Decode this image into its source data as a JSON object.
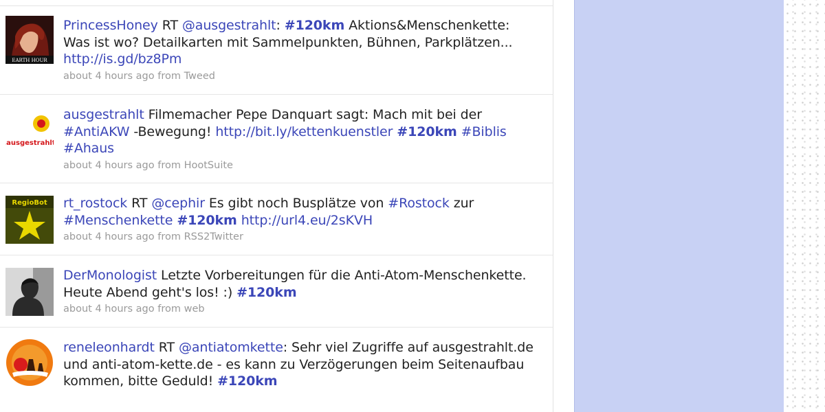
{
  "tweets": [
    {
      "user": "PrincessHoney",
      "avatar_text": "EARTH HOUR",
      "parts": [
        {
          "text": " RT ",
          "kind": "plain"
        },
        {
          "text": "@ausgestrahlt",
          "kind": "mention"
        },
        {
          "text": ": ",
          "kind": "plain"
        },
        {
          "text": "#120km",
          "kind": "hashtag"
        },
        {
          "text": " Aktions&Menschenkette: Was ist wo? Detailkarten mit Sammelpunkten, Bühnen, Parkplätzen... ",
          "kind": "plain"
        },
        {
          "text": "http://is.gd/bz8Pm",
          "kind": "link"
        }
      ],
      "time": "about 4 hours ago",
      "from_word": "from",
      "source": "Tweed"
    },
    {
      "user": "ausgestrahlt",
      "avatar_text": ".ausgestrahlt",
      "parts": [
        {
          "text": " Filmemacher Pepe Danquart sagt: Mach mit bei der ",
          "kind": "plain"
        },
        {
          "text": "#AntiAKW",
          "kind": "mention"
        },
        {
          "text": " -Bewegung! ",
          "kind": "plain"
        },
        {
          "text": "http://bit.ly/kettenkuenstler",
          "kind": "link"
        },
        {
          "text": " ",
          "kind": "plain"
        },
        {
          "text": "#120km",
          "kind": "hashtag"
        },
        {
          "text": " ",
          "kind": "plain"
        },
        {
          "text": "#Biblis",
          "kind": "mention"
        },
        {
          "text": " ",
          "kind": "plain"
        },
        {
          "text": "#Ahaus",
          "kind": "mention"
        }
      ],
      "time": "about 4 hours ago",
      "from_word": "from",
      "source": "HootSuite"
    },
    {
      "user": "rt_rostock",
      "avatar_text": "RegioBot",
      "parts": [
        {
          "text": " RT ",
          "kind": "plain"
        },
        {
          "text": "@cephir",
          "kind": "mention"
        },
        {
          "text": " Es gibt noch Busplätze von ",
          "kind": "plain"
        },
        {
          "text": "#Rostock",
          "kind": "mention"
        },
        {
          "text": " zur ",
          "kind": "plain"
        },
        {
          "text": "#Menschenkette",
          "kind": "mention"
        },
        {
          "text": " ",
          "kind": "plain"
        },
        {
          "text": "#120km",
          "kind": "hashtag"
        },
        {
          "text": " ",
          "kind": "plain"
        },
        {
          "text": "http://url4.eu/2sKVH",
          "kind": "link"
        }
      ],
      "time": "about 4 hours ago",
      "from_word": "from",
      "source": "RSS2Twitter"
    },
    {
      "user": "DerMonologist",
      "avatar_text": "",
      "parts": [
        {
          "text": " Letzte Vorbereitungen für die Anti-Atom-Menschenkette. Heute Abend geht's los! :) ",
          "kind": "plain"
        },
        {
          "text": "#120km",
          "kind": "hashtag"
        }
      ],
      "time": "about 4 hours ago",
      "from_word": "from",
      "source": "web"
    },
    {
      "user": "reneleonhardt",
      "avatar_text": "",
      "parts": [
        {
          "text": " RT ",
          "kind": "plain"
        },
        {
          "text": "@antiatomkette",
          "kind": "mention"
        },
        {
          "text": ": Sehr viel Zugriffe auf ausgestrahlt.de und anti-atom-kette.de - es kann zu Verzögerungen beim Seitenaufbau kommen, bitte Geduld! ",
          "kind": "plain"
        },
        {
          "text": "#120km",
          "kind": "hashtag"
        }
      ],
      "time": "",
      "from_word": "",
      "source": ""
    }
  ],
  "colors": {
    "link": "#3b46b8",
    "sidebar": "#c8d1f4",
    "meta": "#9a9a9a",
    "text": "#222222"
  }
}
